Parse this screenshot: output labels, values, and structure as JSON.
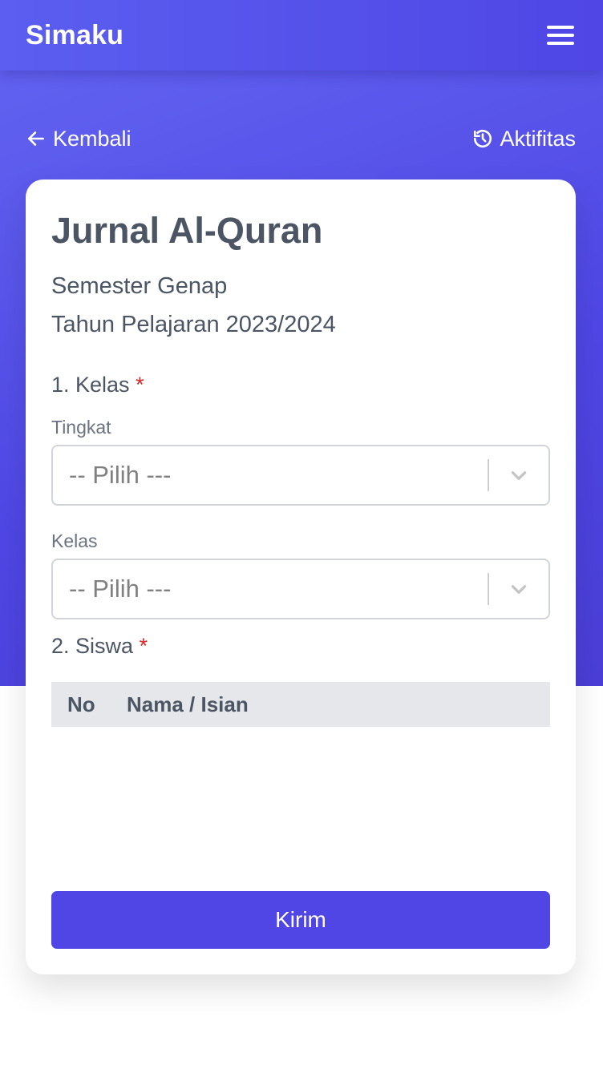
{
  "app": {
    "title": "Simaku"
  },
  "nav": {
    "back_label": "Kembali",
    "activity_label": "Aktifitas"
  },
  "form": {
    "title": "Jurnal Al-Quran",
    "semester": "Semester Genap",
    "year": "Tahun Pelajaran 2023/2024",
    "section1": {
      "label": "1. Kelas",
      "required": "*"
    },
    "tingkat": {
      "label": "Tingkat",
      "value": "-- Pilih ---"
    },
    "kelas": {
      "label": "Kelas",
      "value": "-- Pilih ---"
    },
    "section2": {
      "label": "2. Siswa",
      "required": "*"
    },
    "table": {
      "columns": [
        "No",
        "Nama / Isian"
      ],
      "rows": []
    },
    "submit_label": "Kirim"
  },
  "colors": {
    "primary": "#4f46e5",
    "required": "#dc2626",
    "text": "#4b5563"
  },
  "icons": {
    "menu": "hamburger-icon",
    "back": "arrow-left-icon",
    "activity": "history-icon",
    "dropdown": "chevron-down-icon"
  }
}
